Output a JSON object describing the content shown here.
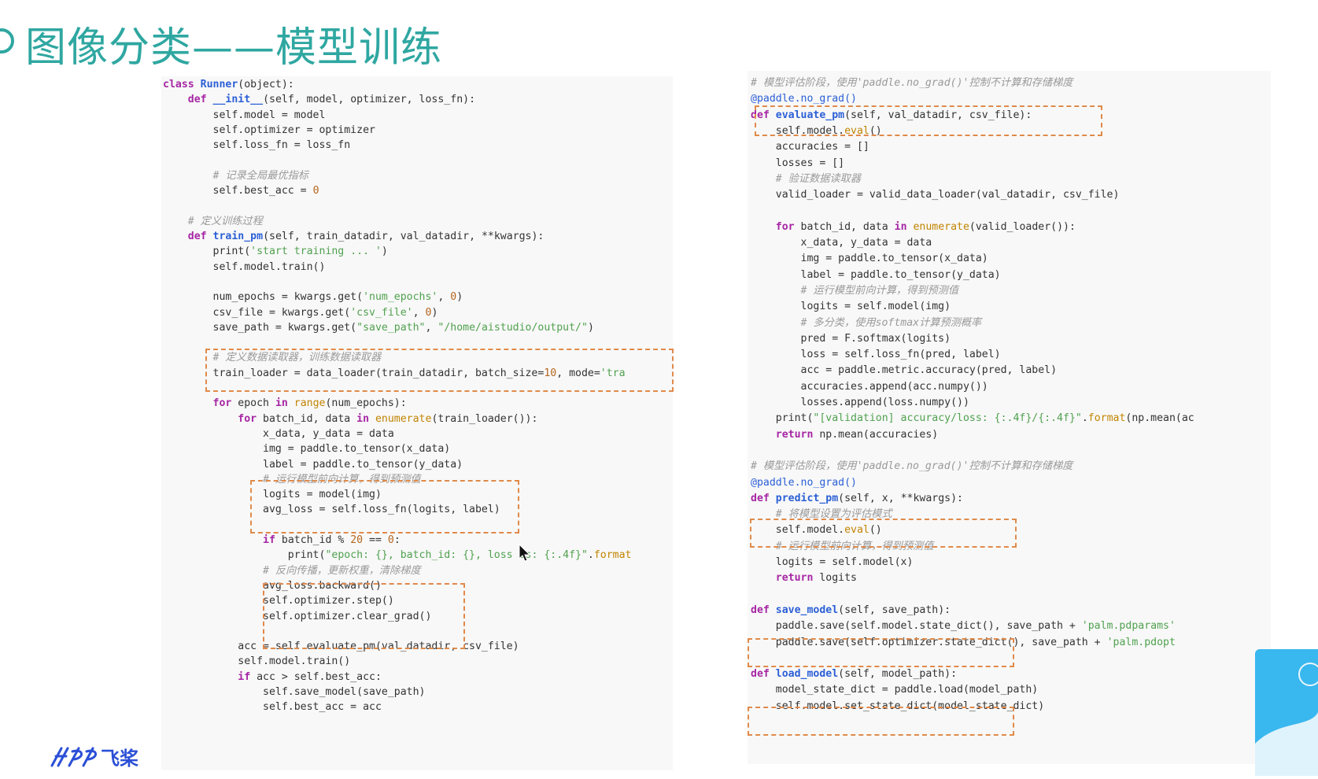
{
  "slide": {
    "title": "图像分类——模型训练",
    "logo_text": "飞桨"
  },
  "colors": {
    "title": "#2fa7a1",
    "highlight_box": "#e08a4a",
    "keyword": "#a626a4",
    "function": "#2b5fd6",
    "string": "#50a14f"
  },
  "icons": {
    "logo": "paddle-logo-icon",
    "cursor": "mouse-cursor-icon"
  },
  "code_left": [
    [
      [
        "kw",
        "class "
      ],
      [
        "fn",
        "Runner"
      ],
      [
        "t",
        "(object):"
      ]
    ],
    [
      [
        "t",
        "    "
      ],
      [
        "kw",
        "def "
      ],
      [
        "fn",
        "__init__"
      ],
      [
        "t",
        "(self, model, optimizer, loss_fn):"
      ]
    ],
    [
      [
        "t",
        "        self.model = model"
      ]
    ],
    [
      [
        "t",
        "        self.optimizer = optimizer"
      ]
    ],
    [
      [
        "t",
        "        self.loss_fn = loss_fn"
      ]
    ],
    [
      [
        "t",
        ""
      ]
    ],
    [
      [
        "t",
        "        "
      ],
      [
        "cm",
        "# 记录全局最优指标"
      ]
    ],
    [
      [
        "t",
        "        self.best_acc = "
      ],
      [
        "num",
        "0"
      ]
    ],
    [
      [
        "t",
        ""
      ]
    ],
    [
      [
        "t",
        "    "
      ],
      [
        "cm",
        "# 定义训练过程"
      ]
    ],
    [
      [
        "t",
        "    "
      ],
      [
        "kw",
        "def "
      ],
      [
        "fn",
        "train_pm"
      ],
      [
        "t",
        "(self, train_datadir, val_datadir, **kwargs):"
      ]
    ],
    [
      [
        "t",
        "        print("
      ],
      [
        "str",
        "'start training ... '"
      ],
      [
        "t",
        ")"
      ]
    ],
    [
      [
        "t",
        "        self.model.train()"
      ]
    ],
    [
      [
        "t",
        ""
      ]
    ],
    [
      [
        "t",
        "        num_epochs = kwargs.get("
      ],
      [
        "str",
        "'num_epochs'"
      ],
      [
        "t",
        ", "
      ],
      [
        "num",
        "0"
      ],
      [
        "t",
        ")"
      ]
    ],
    [
      [
        "t",
        "        csv_file = kwargs.get("
      ],
      [
        "str",
        "'csv_file'"
      ],
      [
        "t",
        ", "
      ],
      [
        "num",
        "0"
      ],
      [
        "t",
        ")"
      ]
    ],
    [
      [
        "t",
        "        save_path = kwargs.get("
      ],
      [
        "str",
        "\"save_path\""
      ],
      [
        "t",
        ", "
      ],
      [
        "str",
        "\"/home/aistudio/output/\""
      ],
      [
        "t",
        ")"
      ]
    ],
    [
      [
        "t",
        ""
      ]
    ],
    [
      [
        "t",
        "        "
      ],
      [
        "cm",
        "# 定义数据读取器，训练数据读取器"
      ]
    ],
    [
      [
        "t",
        "        train_loader = data_loader(train_datadir, batch_size="
      ],
      [
        "num",
        "10"
      ],
      [
        "t",
        ", mode="
      ],
      [
        "str",
        "'tra"
      ]
    ],
    [
      [
        "t",
        ""
      ]
    ],
    [
      [
        "t",
        "        "
      ],
      [
        "kw",
        "for "
      ],
      [
        "t",
        "epoch "
      ],
      [
        "kw",
        "in "
      ],
      [
        "bi",
        "range"
      ],
      [
        "t",
        "(num_epochs):"
      ]
    ],
    [
      [
        "t",
        "            "
      ],
      [
        "kw",
        "for "
      ],
      [
        "t",
        "batch_id, data "
      ],
      [
        "kw",
        "in "
      ],
      [
        "bi",
        "enumerate"
      ],
      [
        "t",
        "(train_loader()):"
      ]
    ],
    [
      [
        "t",
        "                x_data, y_data = data"
      ]
    ],
    [
      [
        "t",
        "                img = paddle.to_tensor(x_data)"
      ]
    ],
    [
      [
        "t",
        "                label = paddle.to_tensor(y_data)"
      ]
    ],
    [
      [
        "t",
        "                "
      ],
      [
        "cm",
        "# 运行模型前向计算，得到预测值"
      ]
    ],
    [
      [
        "t",
        "                logits = model(img)"
      ]
    ],
    [
      [
        "t",
        "                avg_loss = self.loss_fn(logits, label)"
      ]
    ],
    [
      [
        "t",
        ""
      ]
    ],
    [
      [
        "t",
        "                "
      ],
      [
        "kw",
        "if "
      ],
      [
        "t",
        "batch_id % "
      ],
      [
        "num",
        "20"
      ],
      [
        "t",
        " == "
      ],
      [
        "num",
        "0"
      ],
      [
        "t",
        ":"
      ]
    ],
    [
      [
        "t",
        "                    print("
      ],
      [
        "str",
        "\"epoch: {}, batch_id: {}, loss is: {:.4f}\""
      ],
      [
        "t",
        "."
      ],
      [
        "bi",
        "format"
      ]
    ],
    [
      [
        "t",
        "                "
      ],
      [
        "cm",
        "# 反向传播，更新权重，清除梯度"
      ]
    ],
    [
      [
        "t",
        "                avg_loss.backward()"
      ]
    ],
    [
      [
        "t",
        "                self.optimizer.step()"
      ]
    ],
    [
      [
        "t",
        "                self.optimizer.clear_grad()"
      ]
    ],
    [
      [
        "t",
        ""
      ]
    ],
    [
      [
        "t",
        "            acc = self.evaluate_pm(val_datadir, csv_file)"
      ]
    ],
    [
      [
        "t",
        "            self.model.train()"
      ]
    ],
    [
      [
        "t",
        "            "
      ],
      [
        "kw",
        "if "
      ],
      [
        "t",
        "acc > self.best_acc:"
      ]
    ],
    [
      [
        "t",
        "                self.save_model(save_path)"
      ]
    ],
    [
      [
        "t",
        "                self.best_acc = acc"
      ]
    ]
  ],
  "code_right": [
    [
      [
        "cm",
        "# 模型评估阶段，使用'paddle.no_grad()'控制不计算和存储梯度"
      ]
    ],
    [
      [
        "dec",
        "@paddle.no_grad()"
      ]
    ],
    [
      [
        "kw",
        "def "
      ],
      [
        "fn",
        "evaluate_pm"
      ],
      [
        "t",
        "(self, val_datadir, csv_file):"
      ]
    ],
    [
      [
        "t",
        "    self.model."
      ],
      [
        "bi",
        "eval"
      ],
      [
        "t",
        "()"
      ]
    ],
    [
      [
        "t",
        "    accuracies = []"
      ]
    ],
    [
      [
        "t",
        "    losses = []"
      ]
    ],
    [
      [
        "t",
        "    "
      ],
      [
        "cm",
        "# 验证数据读取器"
      ]
    ],
    [
      [
        "t",
        "    valid_loader = valid_data_loader(val_datadir, csv_file)"
      ]
    ],
    [
      [
        "t",
        ""
      ]
    ],
    [
      [
        "t",
        "    "
      ],
      [
        "kw",
        "for "
      ],
      [
        "t",
        "batch_id, data "
      ],
      [
        "kw",
        "in "
      ],
      [
        "bi",
        "enumerate"
      ],
      [
        "t",
        "(valid_loader()):"
      ]
    ],
    [
      [
        "t",
        "        x_data, y_data = data"
      ]
    ],
    [
      [
        "t",
        "        img = paddle.to_tensor(x_data)"
      ]
    ],
    [
      [
        "t",
        "        label = paddle.to_tensor(y_data)"
      ]
    ],
    [
      [
        "t",
        "        "
      ],
      [
        "cm",
        "# 运行模型前向计算，得到预测值"
      ]
    ],
    [
      [
        "t",
        "        logits = self.model(img)"
      ]
    ],
    [
      [
        "t",
        "        "
      ],
      [
        "cm",
        "# 多分类，使用softmax计算预测概率"
      ]
    ],
    [
      [
        "t",
        "        pred = F.softmax(logits)"
      ]
    ],
    [
      [
        "t",
        "        loss = self.loss_fn(pred, label)"
      ]
    ],
    [
      [
        "t",
        "        acc = paddle.metric.accuracy(pred, label)"
      ]
    ],
    [
      [
        "t",
        "        accuracies.append(acc.numpy())"
      ]
    ],
    [
      [
        "t",
        "        losses.append(loss.numpy())"
      ]
    ],
    [
      [
        "t",
        "    print("
      ],
      [
        "str",
        "\"[validation] accuracy/loss: {:.4f}/{:.4f}\""
      ],
      [
        "t",
        "."
      ],
      [
        "bi",
        "format"
      ],
      [
        "t",
        "(np.mean(ac"
      ]
    ],
    [
      [
        "t",
        "    "
      ],
      [
        "kw",
        "return "
      ],
      [
        "t",
        "np.mean(accuracies)"
      ]
    ],
    [
      [
        "t",
        ""
      ]
    ],
    [
      [
        "cm",
        "# 模型评估阶段，使用'paddle.no_grad()'控制不计算和存储梯度"
      ]
    ],
    [
      [
        "dec",
        "@paddle.no_grad()"
      ]
    ],
    [
      [
        "kw",
        "def "
      ],
      [
        "fn",
        "predict_pm"
      ],
      [
        "t",
        "(self, x, **kwargs):"
      ]
    ],
    [
      [
        "t",
        "    "
      ],
      [
        "cm",
        "# 将模型设置为评估模式"
      ]
    ],
    [
      [
        "t",
        "    self.model."
      ],
      [
        "bi",
        "eval"
      ],
      [
        "t",
        "()"
      ]
    ],
    [
      [
        "t",
        "    "
      ],
      [
        "cm",
        "# 运行模型前向计算，得到预测值"
      ]
    ],
    [
      [
        "t",
        "    logits = self.model(x)"
      ]
    ],
    [
      [
        "t",
        "    "
      ],
      [
        "kw",
        "return "
      ],
      [
        "t",
        "logits"
      ]
    ],
    [
      [
        "t",
        ""
      ]
    ],
    [
      [
        "kw",
        "def "
      ],
      [
        "fn",
        "save_model"
      ],
      [
        "t",
        "(self, save_path):"
      ]
    ],
    [
      [
        "t",
        "    paddle.save(self.model.state_dict(), save_path + "
      ],
      [
        "str",
        "'palm.pdparams'"
      ]
    ],
    [
      [
        "t",
        "    paddle.save(self.optimizer.state_dict(), save_path + "
      ],
      [
        "str",
        "'palm.pdopt"
      ]
    ],
    [
      [
        "t",
        ""
      ]
    ],
    [
      [
        "kw",
        "def "
      ],
      [
        "fn",
        "load_model"
      ],
      [
        "t",
        "(self, model_path):"
      ]
    ],
    [
      [
        "t",
        "    model_state_dict = paddle.load(model_path)"
      ]
    ],
    [
      [
        "t",
        "    self.model.set_state_dict(model_state_dict)"
      ]
    ]
  ]
}
